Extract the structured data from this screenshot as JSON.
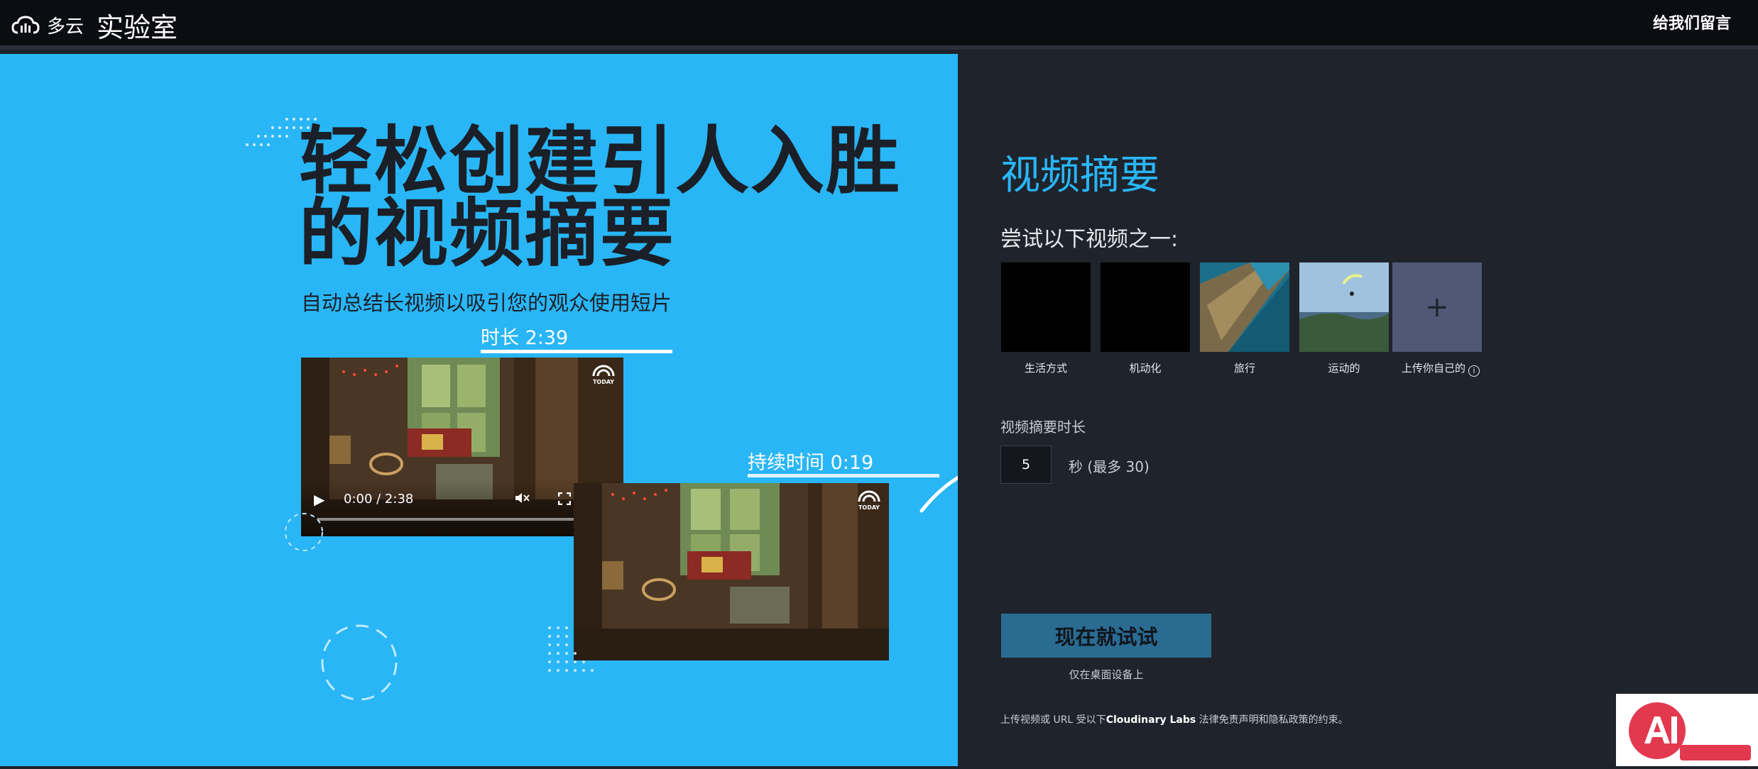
{
  "topbar": {
    "brand": "多云",
    "lab": "实验室",
    "feedback": "给我们留言"
  },
  "hero": {
    "headline_line1": "轻松创建引人入胜",
    "headline_line2": "的视频摘要",
    "subhead": "自动总结长视频以吸引您的观众使用短片",
    "original_duration": "时长 2:39",
    "summary_duration": "持续时间 0:19",
    "player": {
      "time": "0:00 / 2:38"
    }
  },
  "panel": {
    "title": "视频摘要",
    "try_label": "尝试以下视频之一:",
    "samples": [
      {
        "label": "生活方式"
      },
      {
        "label": "机动化"
      },
      {
        "label": "旅行"
      },
      {
        "label": "运动的"
      },
      {
        "label": "上传你自己的"
      }
    ],
    "length_label": "视频摘要时长",
    "length_value": "5",
    "length_unit": "秒 (最多 30)",
    "cta": "现在就试试",
    "cta_note": "仅在桌面设备上",
    "legal_prefix": "上传视频或 URL 受以下",
    "legal_brand": "Cloudinary Labs",
    "legal_suffix": " 法律免责声明和隐私政策的约束。"
  },
  "colors": {
    "accent": "#29b6f6",
    "hero_bg": "#29b6f6",
    "panel_bg": "#1f232c",
    "cta_bg": "#2a6b92"
  }
}
